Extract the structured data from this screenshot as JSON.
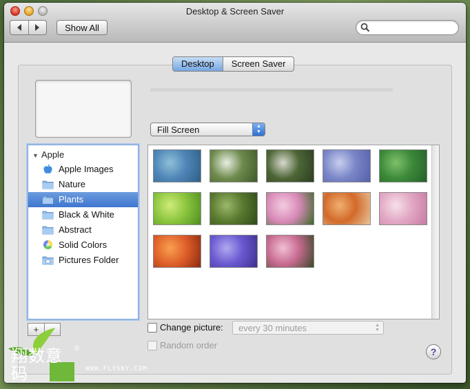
{
  "window": {
    "title": "Desktop & Screen Saver"
  },
  "toolbar": {
    "back_icon": "chevron-left-icon",
    "forward_icon": "chevron-right-icon",
    "show_all_label": "Show All",
    "search_value": "",
    "search_placeholder": ""
  },
  "tabs": [
    {
      "label": "Desktop",
      "active": true
    },
    {
      "label": "Screen Saver",
      "active": false
    }
  ],
  "fill_mode": {
    "selected": "Fill Screen"
  },
  "source_list": {
    "group_label": "Apple",
    "items": [
      {
        "label": "Apple Images",
        "icon": "apple-icon",
        "selected": false
      },
      {
        "label": "Nature",
        "icon": "folder-icon",
        "selected": false
      },
      {
        "label": "Plants",
        "icon": "folder-icon",
        "selected": true
      },
      {
        "label": "Black & White",
        "icon": "folder-icon",
        "selected": false
      },
      {
        "label": "Abstract",
        "icon": "folder-icon",
        "selected": false
      },
      {
        "label": "Solid Colors",
        "icon": "color-wheel-icon",
        "selected": false
      },
      {
        "label": "Pictures Folder",
        "icon": "pictures-folder-icon",
        "selected": false
      }
    ]
  },
  "list_buttons": {
    "add_label": "+",
    "remove_label": "−"
  },
  "thumbnails": [
    {
      "subject": "agave leaves",
      "colors": [
        "#4f86b8",
        "#8fc0d8",
        "#2f5e86"
      ]
    },
    {
      "subject": "white daisies",
      "colors": [
        "#6e8a4c",
        "#e8eee4",
        "#3f5a2a"
      ]
    },
    {
      "subject": "dandelion seed head",
      "colors": [
        "#4d6636",
        "#d8d8cc",
        "#2d3d20"
      ]
    },
    {
      "subject": "purple dandelion",
      "colors": [
        "#7a86c8",
        "#c8cfee",
        "#5560a8"
      ]
    },
    {
      "subject": "grass blades",
      "colors": [
        "#3d8a3a",
        "#7fc06a",
        "#25602a"
      ]
    },
    {
      "subject": "green leaf spiral",
      "colors": [
        "#8cc63f",
        "#d0ea7a",
        "#4e8e20"
      ]
    },
    {
      "subject": "moss",
      "colors": [
        "#5a7a30",
        "#9bb86a",
        "#2f4a1a"
      ]
    },
    {
      "subject": "pink lotus",
      "colors": [
        "#d98ab8",
        "#f3cce0",
        "#3e6a2a"
      ]
    },
    {
      "subject": "orange maple leaves",
      "colors": [
        "#d26a2a",
        "#f0b070",
        "#e8c49a"
      ]
    },
    {
      "subject": "pink flower close-up",
      "colors": [
        "#e2a8c4",
        "#f6e0ea",
        "#c77aa2"
      ]
    },
    {
      "subject": "orange rose",
      "colors": [
        "#e0602a",
        "#f8a050",
        "#8a2a10"
      ]
    },
    {
      "subject": "purple petals",
      "colors": [
        "#6a5ad0",
        "#b0a8f0",
        "#3d2e90"
      ]
    },
    {
      "subject": "pink blossoms",
      "colors": [
        "#c86a90",
        "#f0c0d4",
        "#3a4a28"
      ]
    }
  ],
  "change_picture": {
    "label": "Change picture:",
    "checked": false,
    "interval": "every 30 minutes"
  },
  "random_order": {
    "label": "Random order",
    "checked": false,
    "enabled": false
  },
  "help_label": "?",
  "watermark": {
    "brand_text": "翔数意码",
    "registered_mark": "®",
    "url": "WWW.FLYSKY.COM"
  }
}
